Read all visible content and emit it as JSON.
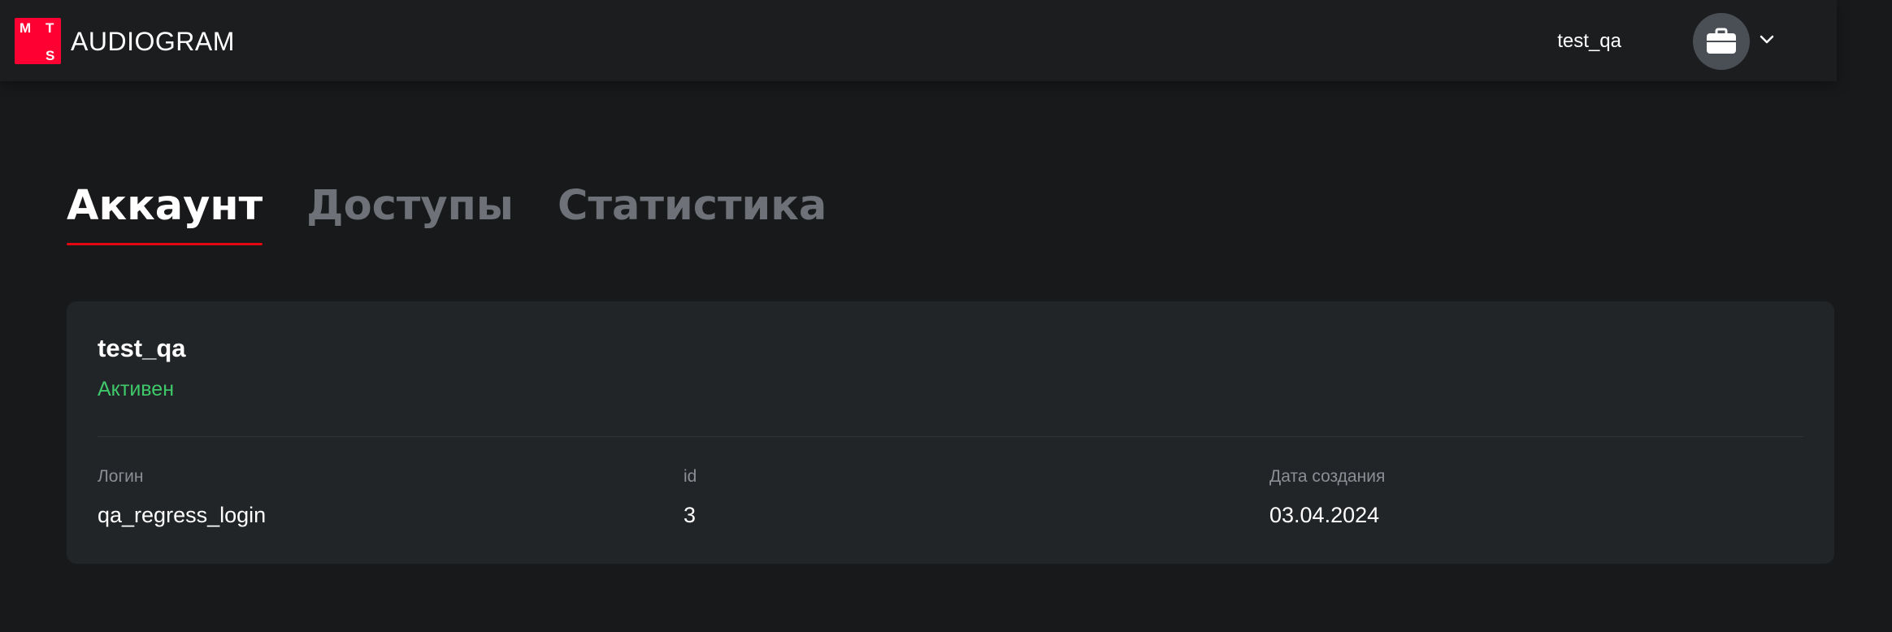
{
  "header": {
    "logo_letters": [
      "M",
      "T",
      "S"
    ],
    "logo_color": "#ff0032",
    "app_title": "AUDIOGRAM",
    "user_name": "test_qa",
    "avatar_icon": "briefcase-icon",
    "menu_icon": "chevron-down-icon"
  },
  "tabs": [
    {
      "label": "Аккаунт",
      "active": true
    },
    {
      "label": "Доступы",
      "active": false
    },
    {
      "label": "Статистика",
      "active": false
    }
  ],
  "account": {
    "name": "test_qa",
    "status": "Активен",
    "status_color": "#3fc86a",
    "fields": [
      {
        "label": "Логин",
        "value": "qa_regress_login"
      },
      {
        "label": "id",
        "value": "3"
      },
      {
        "label": "Дата создания",
        "value": "03.04.2024"
      }
    ]
  },
  "colors": {
    "background": "#18191b",
    "accent": "#e30611",
    "card": "#222528"
  }
}
